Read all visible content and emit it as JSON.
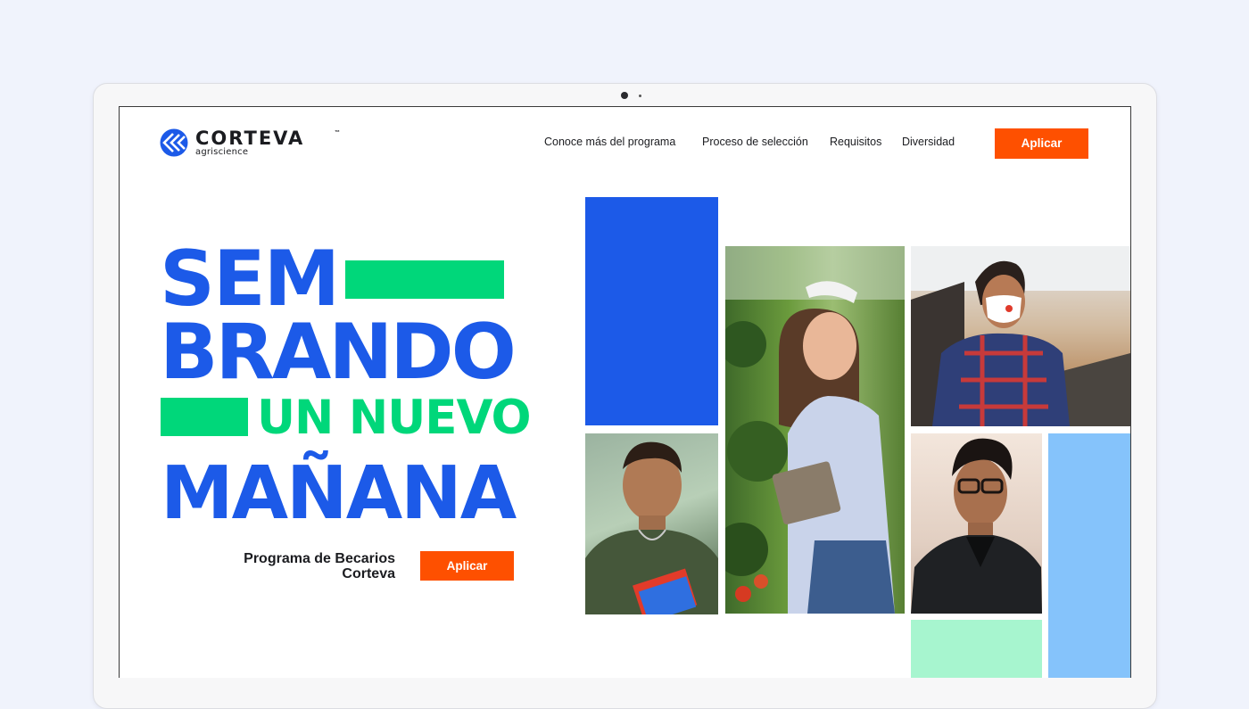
{
  "brand": {
    "name": "CORTEVA",
    "trademark": "™",
    "tagline": "agriscience",
    "colors": {
      "blue": "#1c5ae8",
      "green": "#00d77a",
      "orange": "#fe5000",
      "light_blue": "#85c3fb",
      "mint": "#a7f5cf"
    }
  },
  "nav": {
    "items": [
      {
        "label": "Conoce más del programa"
      },
      {
        "label": "Proceso de selección"
      },
      {
        "label": "Requisitos"
      },
      {
        "label": "Diversidad"
      }
    ],
    "cta_label": "Aplicar"
  },
  "hero": {
    "line1": "SEM",
    "line2": "BRANDO",
    "line3": "UN NUEVO",
    "line4": "MAÑANA",
    "program_line1": "Programa de Becarios",
    "program_line2": "Corteva",
    "cta_label": "Aplicar"
  },
  "collage": {
    "photos": [
      {
        "name": "student-with-notebook"
      },
      {
        "name": "woman-with-tablet-in-field"
      },
      {
        "name": "woman-with-face-mask"
      },
      {
        "name": "young-man-with-glasses"
      }
    ]
  }
}
